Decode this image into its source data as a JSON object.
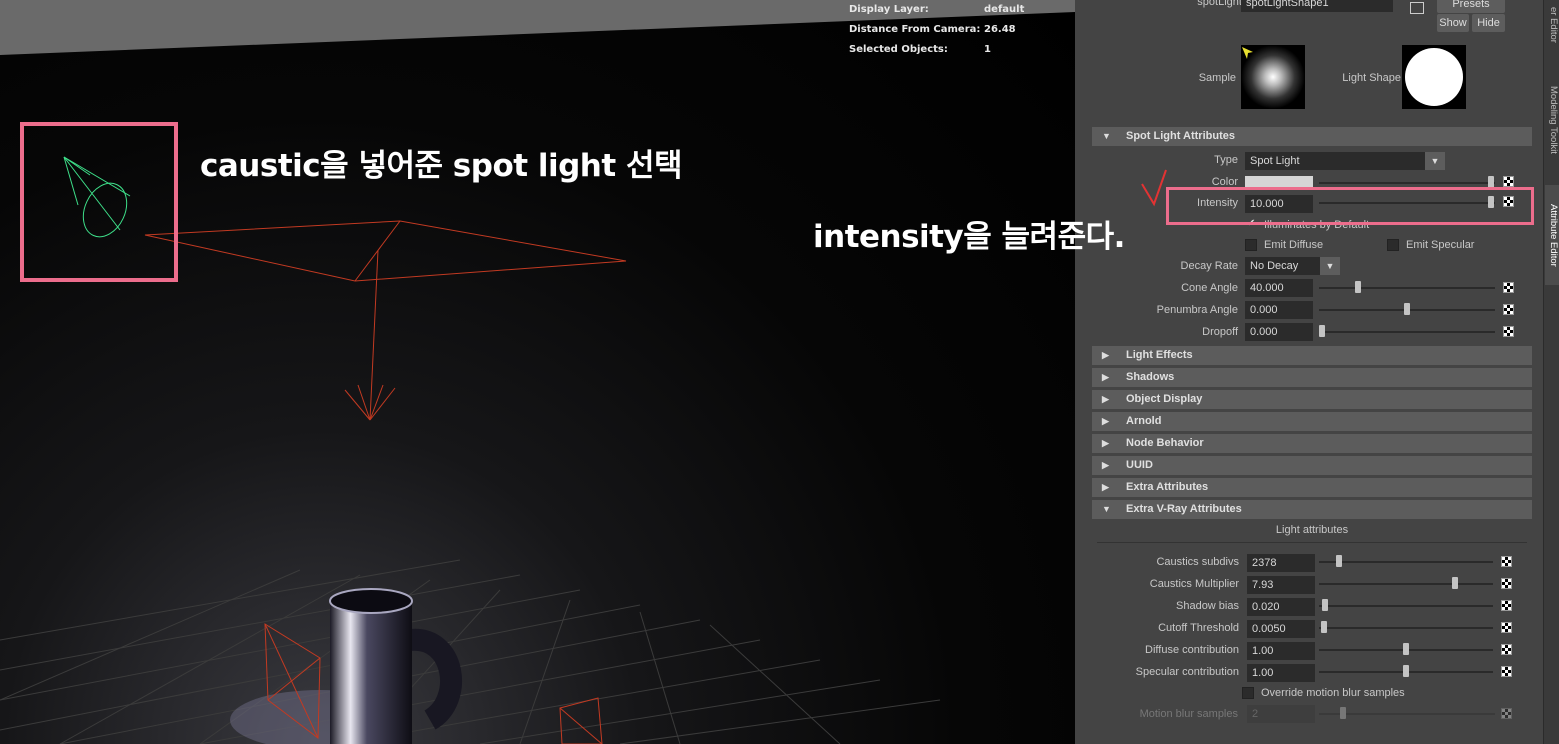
{
  "viewport": {
    "hud": [
      {
        "key": "Display Layer:",
        "value": "default"
      },
      {
        "key": "Distance From Camera:",
        "value": "26.48"
      },
      {
        "key": "Selected Objects:",
        "value": "1"
      }
    ],
    "annotation_select": "caustic을 넣어준 spot light 선택",
    "annotation_intensity": "intensity을 늘려준다."
  },
  "attr": {
    "header": {
      "node_label": "spotLight:",
      "node_name": "spotLightShape1",
      "presets": "Presets",
      "show": "Show",
      "hide": "Hide"
    },
    "sample_label": "Sample",
    "light_shape_label": "Light Shape",
    "spot": {
      "title": "Spot Light Attributes",
      "type_label": "Type",
      "type_value": "Spot Light",
      "color_label": "Color",
      "intensity_label": "Intensity",
      "intensity_value": "10.000",
      "illuminates_label": "Illuminates by Default",
      "emit_diffuse": "Emit Diffuse",
      "emit_specular": "Emit Specular",
      "decay_label": "Decay Rate",
      "decay_value": "No Decay",
      "cone_label": "Cone Angle",
      "cone_value": "40.000",
      "penumbra_label": "Penumbra Angle",
      "penumbra_value": "0.000",
      "dropoff_label": "Dropoff",
      "dropoff_value": "0.000"
    },
    "sections": [
      "Light Effects",
      "Shadows",
      "Object Display",
      "Arnold",
      "Node Behavior",
      "UUID",
      "Extra Attributes"
    ],
    "vray": {
      "title": "Extra V-Ray Attributes",
      "subheader": "Light attributes",
      "rows": [
        {
          "label": "Caustics subdivs",
          "value": "2378",
          "level": 0.1
        },
        {
          "label": "Caustics Multiplier",
          "value": "7.93",
          "level": 0.79
        },
        {
          "label": "Shadow bias",
          "value": "0.020",
          "level": 0.02
        },
        {
          "label": "Cutoff Threshold",
          "value": "0.0050",
          "level": 0.01
        },
        {
          "label": "Diffuse contribution",
          "value": "1.00",
          "level": 0.5
        },
        {
          "label": "Specular contribution",
          "value": "1.00",
          "level": 0.5
        }
      ],
      "override_label": "Override motion blur samples",
      "motion_label": "Motion blur samples",
      "motion_value": "2"
    }
  },
  "side_tabs": [
    "er Editor",
    "Modeling Toolkit",
    "Attribute Editor"
  ]
}
